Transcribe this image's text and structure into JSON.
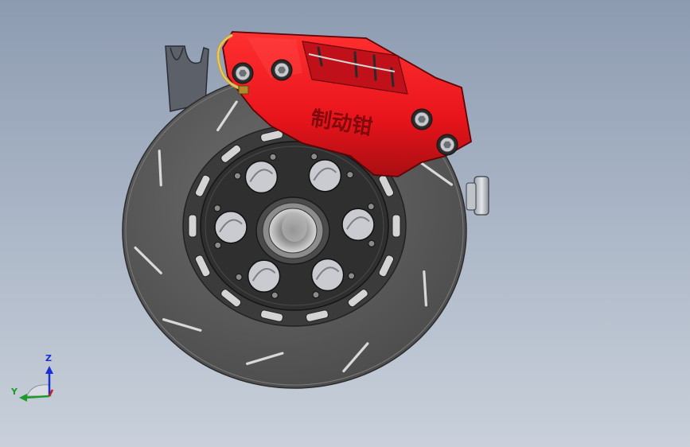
{
  "model": {
    "caliper_text": "制动钳"
  },
  "triad": {
    "z_label": "Z",
    "y_label": "Y"
  },
  "colors": {
    "background_top": "#8d9bb1",
    "background_bottom": "#c9d0da",
    "caliper": "#e8141b",
    "disc": "#5d5d5d",
    "hub": "#2d2d2d",
    "axis_z": "#1a2fd0",
    "axis_y": "#1c9a2a",
    "axis_x": "#c81e1e"
  }
}
